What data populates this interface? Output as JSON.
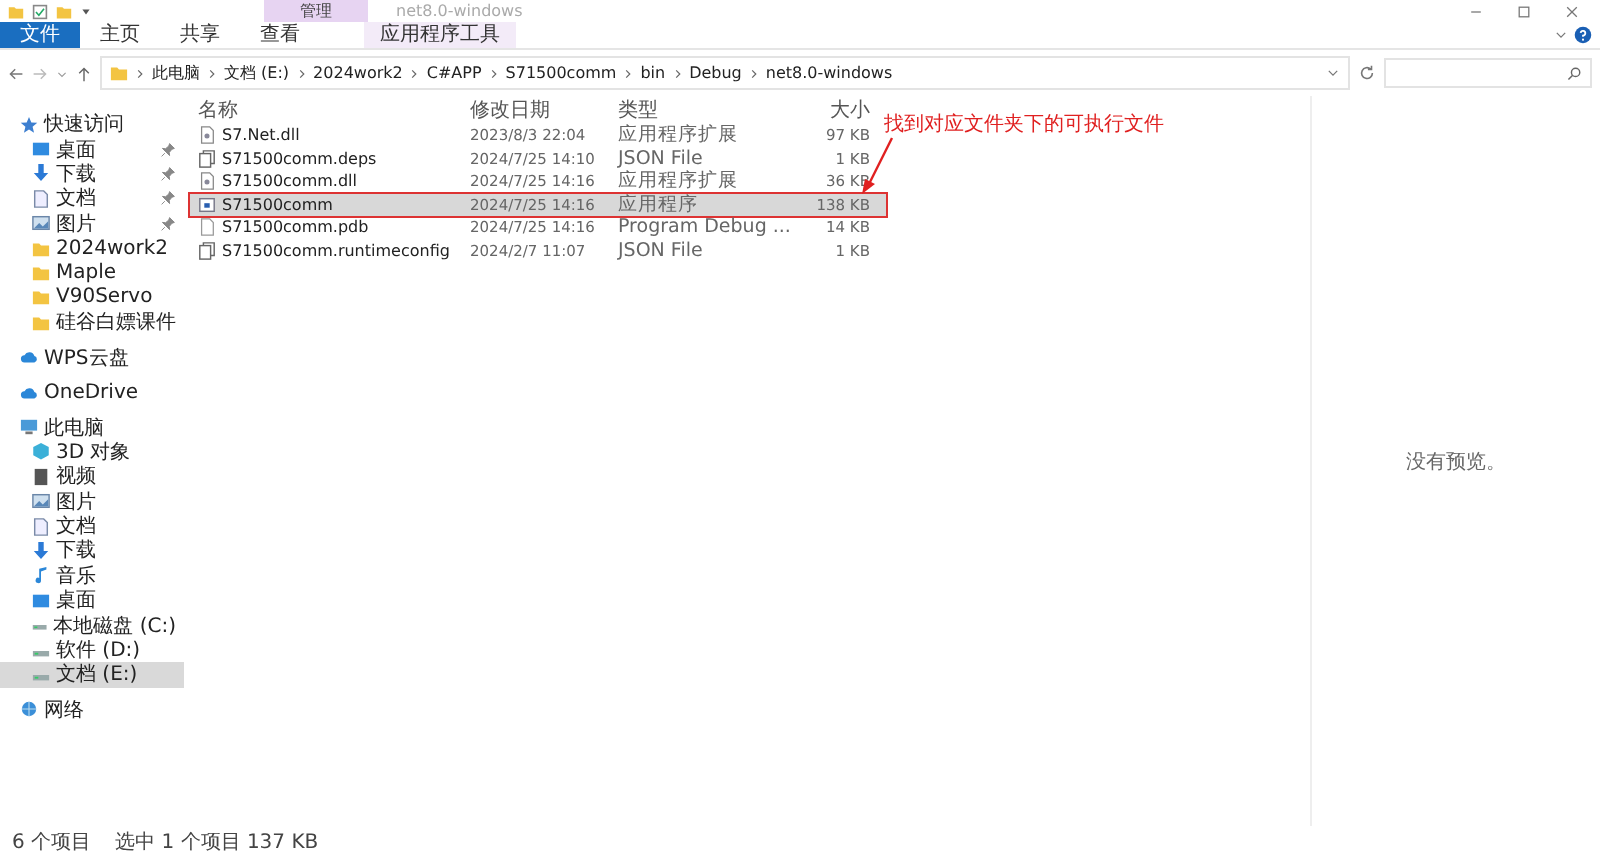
{
  "window": {
    "title": "net8.0-windows",
    "context_tab": "管理"
  },
  "ribbon_tabs": [
    {
      "label": "文件",
      "kind": "file"
    },
    {
      "label": "主页",
      "kind": "tab"
    },
    {
      "label": "共享",
      "kind": "tab"
    },
    {
      "label": "查看",
      "kind": "tab"
    },
    {
      "label": "应用程序工具",
      "kind": "context"
    }
  ],
  "breadcrumb": [
    "此电脑",
    "文档 (E:)",
    "2024work2",
    "C#APP",
    "S71500comm",
    "bin",
    "Debug",
    "net8.0-windows"
  ],
  "sidebar": [
    {
      "label": "快速访问",
      "kind": "star",
      "selected": false,
      "children": [
        {
          "label": "桌面",
          "kind": "desktop",
          "pinned": true,
          "selected": false
        },
        {
          "label": "下载",
          "kind": "download",
          "pinned": true,
          "selected": false
        },
        {
          "label": "文档",
          "kind": "doc",
          "pinned": true,
          "selected": false
        },
        {
          "label": "图片",
          "kind": "picture",
          "pinned": true,
          "selected": false
        },
        {
          "label": "2024work2",
          "kind": "folder",
          "pinned": false,
          "selected": false
        },
        {
          "label": "Maple",
          "kind": "folder",
          "pinned": false,
          "selected": false
        },
        {
          "label": "V90Servo",
          "kind": "folder",
          "pinned": false,
          "selected": false
        },
        {
          "label": "硅谷白嫖课件",
          "kind": "folder",
          "pinned": false,
          "selected": false
        }
      ]
    },
    {
      "label": "WPS云盘",
      "kind": "cloud",
      "selected": false
    },
    {
      "label": "OneDrive",
      "kind": "cloud",
      "selected": false
    },
    {
      "label": "此电脑",
      "kind": "pc",
      "selected": false,
      "children": [
        {
          "label": "3D 对象",
          "kind": "cube",
          "pinned": false,
          "selected": false
        },
        {
          "label": "视频",
          "kind": "video",
          "pinned": false,
          "selected": false
        },
        {
          "label": "图片",
          "kind": "picture",
          "pinned": false,
          "selected": false
        },
        {
          "label": "文档",
          "kind": "doc",
          "pinned": false,
          "selected": false
        },
        {
          "label": "下载",
          "kind": "download",
          "pinned": false,
          "selected": false
        },
        {
          "label": "音乐",
          "kind": "music",
          "pinned": false,
          "selected": false
        },
        {
          "label": "桌面",
          "kind": "desktop",
          "pinned": false,
          "selected": false
        },
        {
          "label": "本地磁盘 (C:)",
          "kind": "drive",
          "pinned": false,
          "selected": false
        },
        {
          "label": "软件 (D:)",
          "kind": "drive",
          "pinned": false,
          "selected": false
        },
        {
          "label": "文档 (E:)",
          "kind": "drive",
          "pinned": false,
          "selected": true
        }
      ]
    },
    {
      "label": "网络",
      "kind": "network",
      "selected": false
    }
  ],
  "columns": [
    "名称",
    "修改日期",
    "类型",
    "大小"
  ],
  "files": [
    {
      "name": "S7.Net.dll",
      "date": "2023/8/3 22:04",
      "type": "应用程序扩展",
      "size": "97 KB",
      "kind": "dll",
      "selected": false
    },
    {
      "name": "S71500comm.deps",
      "date": "2024/7/25 14:10",
      "type": "JSON File",
      "size": "1 KB",
      "kind": "json",
      "selected": false
    },
    {
      "name": "S71500comm.dll",
      "date": "2024/7/25 14:16",
      "type": "应用程序扩展",
      "size": "36 KB",
      "kind": "dll",
      "selected": false
    },
    {
      "name": "S71500comm",
      "date": "2024/7/25 14:16",
      "type": "应用程序",
      "size": "138 KB",
      "kind": "exe",
      "selected": true
    },
    {
      "name": "S71500comm.pdb",
      "date": "2024/7/25 14:16",
      "type": "Program Debug ...",
      "size": "14 KB",
      "kind": "pdb",
      "selected": false
    },
    {
      "name": "S71500comm.runtimeconfig",
      "date": "2024/2/7 11:07",
      "type": "JSON File",
      "size": "1 KB",
      "kind": "json",
      "selected": false
    }
  ],
  "annotation": "找到对应文件夹下的可执行文件",
  "preview": "没有预览。",
  "status_bar": {
    "count": "6 个项目",
    "selection": "选中 1 个项目  137 KB"
  }
}
